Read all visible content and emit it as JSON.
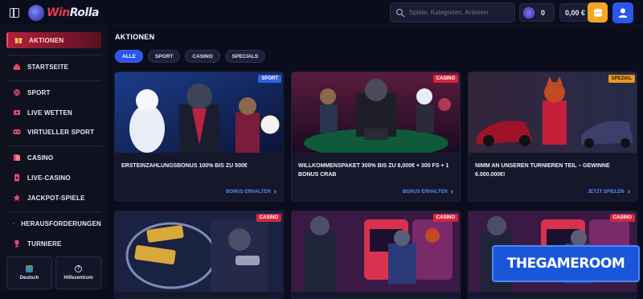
{
  "header": {
    "search_placeholder": "Spiele, Kategorien, Anbieter",
    "token_value": "0",
    "balance": "0,00 €"
  },
  "sidebar": {
    "items": [
      {
        "label": "Aktionen",
        "icon": "gift-icon",
        "active": true
      },
      {
        "label": "Startseite",
        "icon": "home-icon"
      },
      {
        "label": "Sport",
        "icon": "ball-icon"
      },
      {
        "label": "Live Wetten",
        "icon": "live-icon"
      },
      {
        "label": "Virtueller Sport",
        "icon": "virtual-icon"
      },
      {
        "label": "Casino",
        "icon": "cards-icon"
      },
      {
        "label": "Live-Casino",
        "icon": "live-casino-icon"
      },
      {
        "label": "Jackpot-Spiele",
        "icon": "jackpot-icon"
      },
      {
        "label": "Herausforderungen",
        "icon": "challenge-icon"
      },
      {
        "label": "Turniere",
        "icon": "trophy-icon"
      }
    ],
    "language": "Deutsch",
    "help": "Hilfezentrum"
  },
  "main": {
    "title": "Aktionen",
    "filters": [
      "Alle",
      "Sport",
      "Casino",
      "Specials"
    ],
    "cards": [
      {
        "badge": "Sport",
        "badge_type": "sport",
        "desc": "Ersteinzahlungsbonus 100% bis zu 500€",
        "cta": "Bonus erhalten"
      },
      {
        "badge": "Casino",
        "badge_type": "casino",
        "desc": "Willkommenspaket 300% bis zu 8,000€ + 300 FS + 1 Bonus Crab",
        "cta": "Bonus erhalten"
      },
      {
        "badge": "Spezial",
        "badge_type": "special",
        "desc": "Nimm an unseren Turnieren teil – Gewinne 6.000.000€!",
        "cta": "Jetzt spielen"
      },
      {
        "badge": "Casino",
        "badge_type": "casino"
      },
      {
        "badge": "Casino",
        "badge_type": "casino"
      },
      {
        "badge": "Casino",
        "badge_type": "casino"
      }
    ]
  },
  "watermark": "THEGAMEROOM",
  "colors": {
    "accent": "#2a57e8",
    "casino": "#d2283f",
    "sport": "#2f62e0",
    "special": "#e79a1f",
    "wallet": "#f5a623"
  }
}
